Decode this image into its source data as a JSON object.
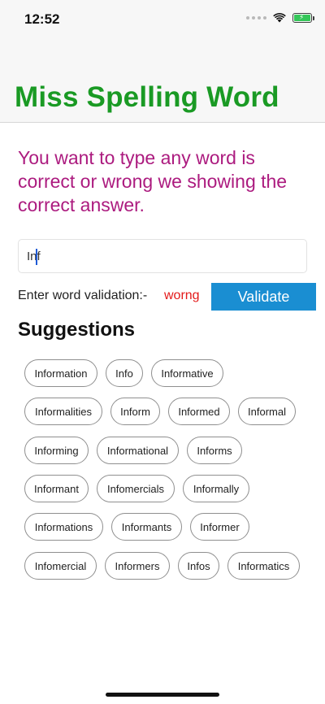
{
  "status_bar": {
    "time": "12:52"
  },
  "header": {
    "title": "Miss Spelling Word"
  },
  "description": "You want to type any word is correct or wrong we showing the correct answer.",
  "search": {
    "value": "Inf"
  },
  "validation": {
    "label": "Enter word validation:-",
    "result": "worng",
    "button_label": "Validate"
  },
  "suggestions": {
    "heading": "Suggestions",
    "items": [
      "Information",
      "Info",
      "Informative",
      "Informalities",
      "Inform",
      "Informed",
      "Informal",
      "Informing",
      "Informational",
      "Informs",
      "Informant",
      "Infomercials",
      "Informally",
      "Informations",
      "Informants",
      "Informer",
      "Infomercial",
      "Informers",
      "Infos",
      "Informatics"
    ]
  },
  "colors": {
    "title": "#1a9a24",
    "description": "#ac1b7f",
    "button": "#1a8ed2",
    "error": "#e31919"
  }
}
